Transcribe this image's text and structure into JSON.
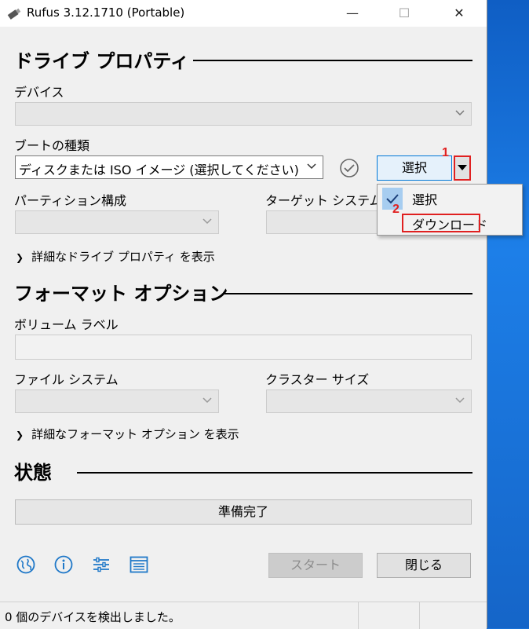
{
  "window": {
    "title": "Rufus 3.12.1710 (Portable)",
    "minimize_glyph": "—",
    "maximize_glyph": "☐",
    "close_glyph": "✕"
  },
  "drive_properties": {
    "heading": "ドライブ プロパティ",
    "device_label": "デバイス",
    "device_value": "",
    "boot_label": "ブートの種類",
    "boot_value": "ディスクまたは ISO イメージ (選択してください)",
    "select_button": "選択",
    "partition_label": "パーティション構成",
    "target_label": "ターゲット システム",
    "advanced_toggle": "詳細なドライブ プロパティ を表示"
  },
  "select_menu": {
    "items": [
      {
        "label": "選択",
        "checked": true
      },
      {
        "label": "ダウンロード",
        "checked": false
      }
    ]
  },
  "format_options": {
    "heading": "フォーマット オプション",
    "volume_label": "ボリューム ラベル",
    "volume_value": "",
    "filesystem_label": "ファイル システム",
    "cluster_label": "クラスター サイズ",
    "advanced_toggle": "詳細なフォーマット オプション を表示"
  },
  "status": {
    "heading": "状態",
    "progress_text": "準備完了",
    "progress_fraction": 0
  },
  "footer": {
    "start_button": "スタート",
    "close_button": "閉じる",
    "icons": [
      "globe-icon",
      "info-icon",
      "settings-icon",
      "log-icon"
    ]
  },
  "statusbar": {
    "text": "0 個のデバイスを検出しました。"
  },
  "annotations": {
    "marker_1": "1",
    "marker_2": "2",
    "color": "#e02020"
  },
  "colors": {
    "accent": "#0078d7",
    "desktop": "#1a72d6"
  }
}
